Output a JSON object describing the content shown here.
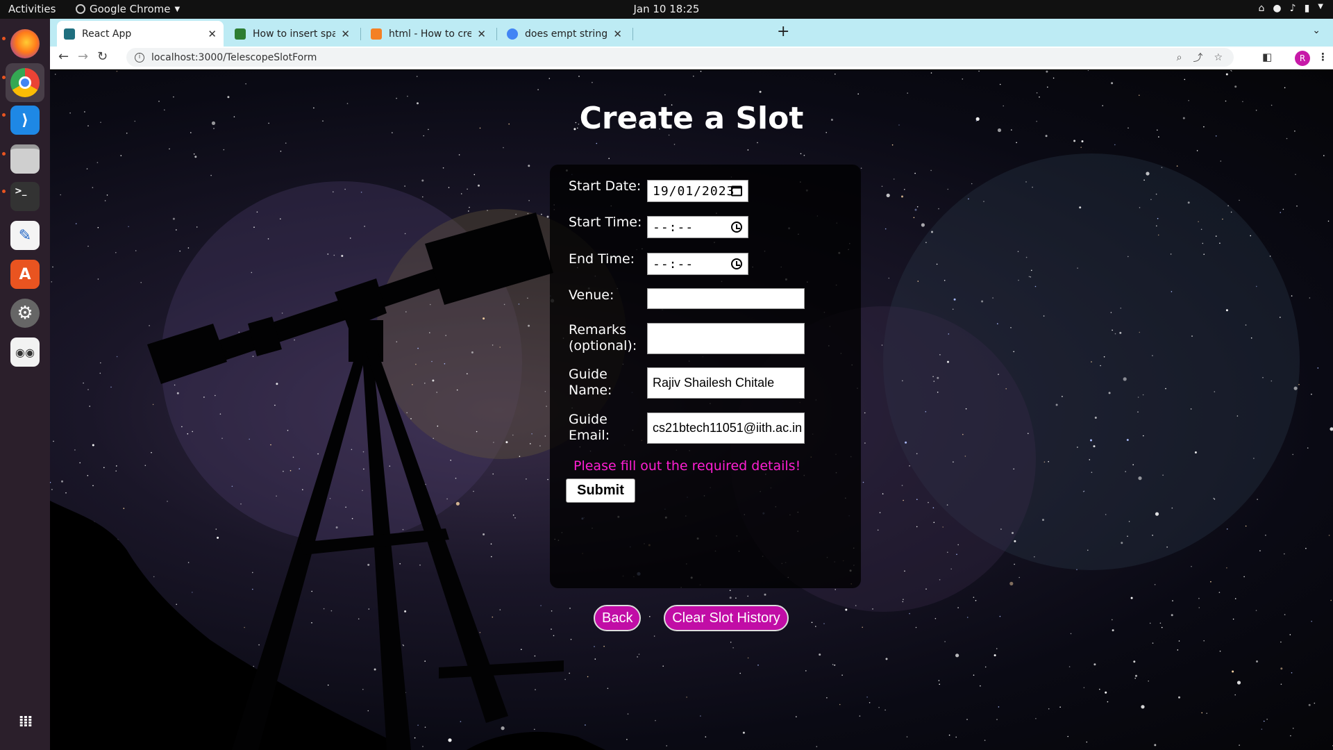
{
  "topbar": {
    "activities": "Activities",
    "app_name": "Google Chrome",
    "clock": "Jan 10  18:25"
  },
  "browser": {
    "tabs": [
      {
        "title": "React App",
        "favicon_color": "#1f6f7f",
        "active": true
      },
      {
        "title": "How to insert spaces/tab",
        "favicon_color": "#2e7d32",
        "active": false
      },
      {
        "title": "html - How to create a ma",
        "favicon_color": "#f48024",
        "active": false
      },
      {
        "title": "does empt string act as nu",
        "favicon_color": "#4285f4",
        "active": false
      }
    ],
    "url": "localhost:3000/TelescopeSlotForm",
    "profile_initial": "R"
  },
  "page": {
    "title": "Create a Slot",
    "form": {
      "start_date_label": "Start Date:",
      "start_date_value": "19/01/2023",
      "start_time_label": "Start Time:",
      "start_time_value": "--:--",
      "end_time_label": "End Time:",
      "end_time_value": "--:--",
      "venue_label": "Venue:",
      "venue_value": "",
      "remarks_label": "Remarks (optional):",
      "remarks_value": "",
      "guide_name_label": "Guide Name:",
      "guide_name_value": "Rajiv Shailesh Chitale",
      "guide_email_label": "Guide Email:",
      "guide_email_value": "cs21btech11051@iith.ac.in",
      "error_message": "Please fill out the required details!",
      "submit_label": "Submit"
    },
    "back_label": "Back",
    "clear_label": "Clear Slot History"
  },
  "colors": {
    "accent_pill": "#c10da6",
    "error_text": "#ff1fd3",
    "tabstrip": "#bdebf4"
  }
}
